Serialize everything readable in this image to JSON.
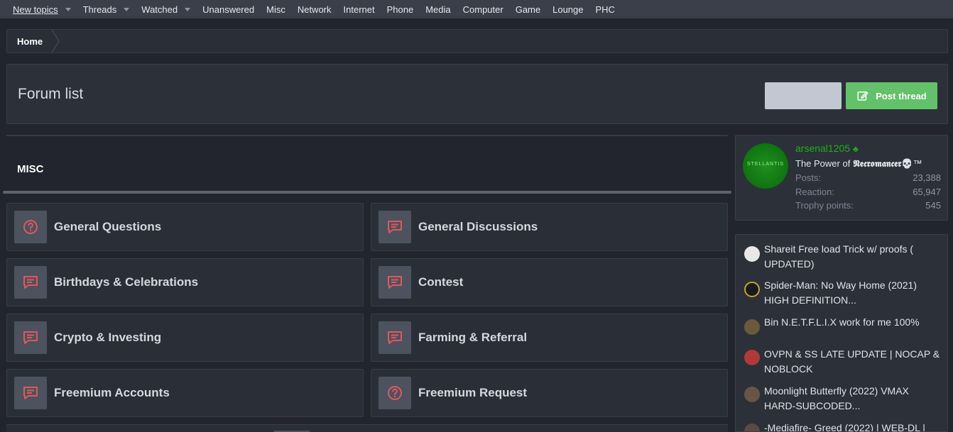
{
  "nav": {
    "items": [
      {
        "label": "New topics",
        "caret": true,
        "active": true
      },
      {
        "label": "Threads",
        "caret": true
      },
      {
        "label": "Watched",
        "caret": true
      },
      {
        "label": "Unanswered"
      },
      {
        "label": "Misc"
      },
      {
        "label": "Network"
      },
      {
        "label": "Internet"
      },
      {
        "label": "Phone"
      },
      {
        "label": "Media"
      },
      {
        "label": "Computer"
      },
      {
        "label": "Game"
      },
      {
        "label": "Lounge"
      },
      {
        "label": "PHC"
      }
    ]
  },
  "breadcrumb": {
    "home": "Home"
  },
  "header": {
    "title": "Forum list",
    "post_thread": "Post thread"
  },
  "category": {
    "title": "MISC",
    "forums": [
      {
        "name": "General Questions",
        "icon": "question-icon"
      },
      {
        "name": "General Discussions",
        "icon": "chat-icon"
      },
      {
        "name": "Birthdays & Celebrations",
        "icon": "chat-icon"
      },
      {
        "name": "Contest",
        "icon": "chat-icon"
      },
      {
        "name": "Crypto & Investing",
        "icon": "chat-icon"
      },
      {
        "name": "Farming & Referral",
        "icon": "chat-icon"
      },
      {
        "name": "Freemium Accounts",
        "icon": "chat-icon"
      },
      {
        "name": "Freemium Request",
        "icon": "question-icon"
      }
    ]
  },
  "member": {
    "username": "arsenal1205",
    "avatar_text": "STELLANTIS",
    "title_prefix": "The Power of ",
    "title_fancy": "𝕹𝖊𝖈𝖗𝖔𝖒𝖆𝖓𝖈𝖊𝖗",
    "title_suffix": "💀™",
    "stats": [
      {
        "label": "Posts:",
        "value": "23,388"
      },
      {
        "label": "Reaction:",
        "value": "65,947"
      },
      {
        "label": "Trophy points:",
        "value": "545"
      }
    ]
  },
  "threads": [
    {
      "title": "Shareit Free load Trick w/ proofs ( UPDATED)"
    },
    {
      "title": "Spider-Man: No Way Home (2021) HIGH DEFINITION..."
    },
    {
      "title": "Bin N.E.T.F.L.I.X work for me 100%"
    },
    {
      "title": "OVPN & SS LATE UPDATE | NOCAP & NOBLOCK"
    },
    {
      "title": "Moonlight Butterfly (2022) VMAX HARD-SUBCODED..."
    },
    {
      "title": "-Mediafire- Greed (2022) | WEB-DL |"
    }
  ],
  "colors": {
    "accent_green": "#63c169",
    "username_green": "#19b319",
    "icon_red": "#e0585a"
  }
}
